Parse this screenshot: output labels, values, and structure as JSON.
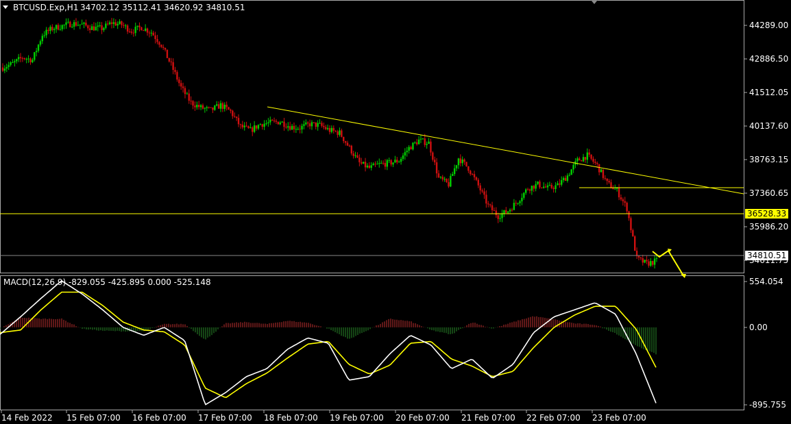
{
  "header": {
    "symbol_label": "BTCUSD.Exp,H1",
    "ohlc_label": "34702.12 35112.41 34620.92 34810.51"
  },
  "macd": {
    "label": "MACD(12,26,9) -829.055 -425.895 0.000 -525.148",
    "scale_labels": [
      "554.054",
      "0.00",
      "-895.755"
    ]
  },
  "price_axis_labels": [
    "44289.00",
    "42886.50",
    "41512.05",
    "40137.60",
    "38763.15",
    "37360.65",
    "35986.20",
    "34611.75"
  ],
  "price_boxes": {
    "level_label": "36528.33",
    "current_label": "34810.51"
  },
  "time_axis_labels": [
    "14 Feb 2022",
    "15 Feb 07:00",
    "16 Feb 07:00",
    "17 Feb 07:00",
    "18 Feb 07:00",
    "19 Feb 07:00",
    "20 Feb 07:00",
    "21 Feb 07:00",
    "22 Feb 07:00",
    "23 Feb 07:00"
  ],
  "colors": {
    "bull": "#00d000",
    "bear": "#d01010",
    "trendline": "#ffff00",
    "macd_main": "#ffffff",
    "macd_signal": "#ffff00",
    "hist_pos": "#c03030",
    "hist_neg": "#2a8a2a",
    "grid": "#aaaaaa"
  },
  "chart_data": {
    "type": "candlestick",
    "symbol": "BTCUSD.Exp",
    "timeframe": "H1",
    "ylim": [
      34400,
      44800
    ],
    "close_path": [
      [
        0,
        42500
      ],
      [
        5,
        42650
      ],
      [
        10,
        42900
      ],
      [
        15,
        42800
      ],
      [
        20,
        43800
      ],
      [
        25,
        44050
      ],
      [
        30,
        44150
      ],
      [
        35,
        44250
      ],
      [
        40,
        44200
      ],
      [
        45,
        44080
      ],
      [
        50,
        44050
      ],
      [
        55,
        44280
      ],
      [
        60,
        44200
      ],
      [
        65,
        43950
      ],
      [
        70,
        44100
      ],
      [
        75,
        43900
      ],
      [
        80,
        43400
      ],
      [
        85,
        42600
      ],
      [
        90,
        41700
      ],
      [
        95,
        41100
      ],
      [
        100,
        40900
      ],
      [
        105,
        40800
      ],
      [
        110,
        41000
      ],
      [
        115,
        40750
      ],
      [
        120,
        40150
      ],
      [
        125,
        40000
      ],
      [
        130,
        40250
      ],
      [
        135,
        40300
      ],
      [
        140,
        40350
      ],
      [
        145,
        40150
      ],
      [
        150,
        40100
      ],
      [
        155,
        40250
      ],
      [
        160,
        40200
      ],
      [
        165,
        40000
      ],
      [
        170,
        39900
      ],
      [
        175,
        39300
      ],
      [
        180,
        38700
      ],
      [
        185,
        38500
      ],
      [
        190,
        38650
      ],
      [
        195,
        38700
      ],
      [
        200,
        38800
      ],
      [
        205,
        39300
      ],
      [
        210,
        39600
      ],
      [
        215,
        39500
      ],
      [
        220,
        38100
      ],
      [
        225,
        37850
      ],
      [
        230,
        38900
      ],
      [
        235,
        38500
      ],
      [
        240,
        37800
      ],
      [
        245,
        37000
      ],
      [
        250,
        36600
      ],
      [
        255,
        36800
      ],
      [
        260,
        37200
      ],
      [
        265,
        37700
      ],
      [
        270,
        37850
      ],
      [
        275,
        37700
      ],
      [
        280,
        37800
      ],
      [
        285,
        38200
      ],
      [
        290,
        38800
      ],
      [
        295,
        39000
      ],
      [
        300,
        38600
      ],
      [
        305,
        37900
      ],
      [
        310,
        37600
      ],
      [
        315,
        36900
      ],
      [
        320,
        34900
      ],
      [
        325,
        34700
      ],
      [
        330,
        34810
      ]
    ],
    "trendlines": {
      "descending": {
        "from": [
          0,
          41100
        ],
        "to": [
          1,
          37300
        ]
      },
      "horizontal_levels": [
        36528.33,
        34810.51
      ],
      "short_resistance": 37360.65
    },
    "macd": {
      "fast": 12,
      "slow": 26,
      "signal": [
        [
          0,
          -60
        ],
        [
          10,
          -30
        ],
        [
          20,
          200
        ],
        [
          30,
          400
        ],
        [
          40,
          400
        ],
        [
          50,
          250
        ],
        [
          60,
          60
        ],
        [
          70,
          -30
        ],
        [
          80,
          -50
        ],
        [
          90,
          -200
        ],
        [
          100,
          -690
        ],
        [
          110,
          -800
        ],
        [
          120,
          -640
        ],
        [
          130,
          -520
        ],
        [
          140,
          -350
        ],
        [
          150,
          -190
        ],
        [
          160,
          -160
        ],
        [
          170,
          -420
        ],
        [
          180,
          -530
        ],
        [
          190,
          -430
        ],
        [
          200,
          -180
        ],
        [
          210,
          -160
        ],
        [
          220,
          -360
        ],
        [
          230,
          -440
        ],
        [
          240,
          -560
        ],
        [
          250,
          -500
        ],
        [
          260,
          -230
        ],
        [
          270,
          0
        ],
        [
          280,
          140
        ],
        [
          290,
          240
        ],
        [
          300,
          240
        ],
        [
          310,
          -20
        ],
        [
          320,
          -470
        ]
      ],
      "ylim": [
        -895.755,
        554.054
      ],
      "main": [
        [
          0,
          -80
        ],
        [
          10,
          120
        ],
        [
          20,
          330
        ],
        [
          30,
          530
        ],
        [
          40,
          380
        ],
        [
          50,
          200
        ],
        [
          60,
          0
        ],
        [
          70,
          -90
        ],
        [
          80,
          0
        ],
        [
          90,
          -150
        ],
        [
          100,
          -880
        ],
        [
          110,
          -740
        ],
        [
          120,
          -560
        ],
        [
          130,
          -470
        ],
        [
          140,
          -250
        ],
        [
          150,
          -120
        ],
        [
          160,
          -180
        ],
        [
          170,
          -600
        ],
        [
          180,
          -560
        ],
        [
          190,
          -300
        ],
        [
          200,
          -90
        ],
        [
          210,
          -200
        ],
        [
          220,
          -470
        ],
        [
          230,
          -360
        ],
        [
          240,
          -580
        ],
        [
          250,
          -420
        ],
        [
          260,
          -60
        ],
        [
          270,
          120
        ],
        [
          280,
          200
        ],
        [
          290,
          280
        ],
        [
          300,
          150
        ],
        [
          310,
          -300
        ],
        [
          320,
          -880
        ]
      ]
    }
  }
}
